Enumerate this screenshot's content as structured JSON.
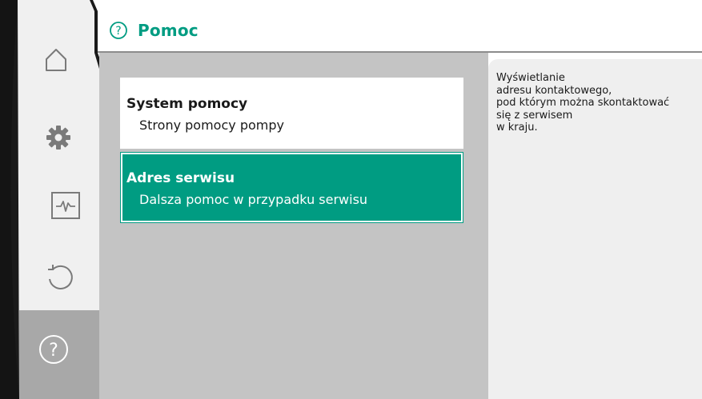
{
  "header": {
    "title": "Pomoc",
    "icon": "help-circle-icon",
    "accent_color": "#009c82"
  },
  "sidebar": {
    "items": [
      {
        "icon": "home-icon",
        "active": false
      },
      {
        "icon": "settings-gear-icon",
        "active": false
      },
      {
        "icon": "diagnostics-pulse-icon",
        "active": false
      },
      {
        "icon": "restore-icon",
        "active": false
      },
      {
        "icon": "help-circle-icon",
        "active": true
      }
    ]
  },
  "menu": {
    "items": [
      {
        "label": "System pomocy",
        "sublabel": "Strony pomocy pompy",
        "selected": false
      },
      {
        "label": "Adres serwisu",
        "sublabel": "Dalsza pomoc w przypadku serwisu",
        "selected": true
      }
    ]
  },
  "help_panel": {
    "text": "Wyświetlanie\nadresu kontaktowego,\npod którym można skontaktować\nsię z serwisem\nw kraju."
  }
}
